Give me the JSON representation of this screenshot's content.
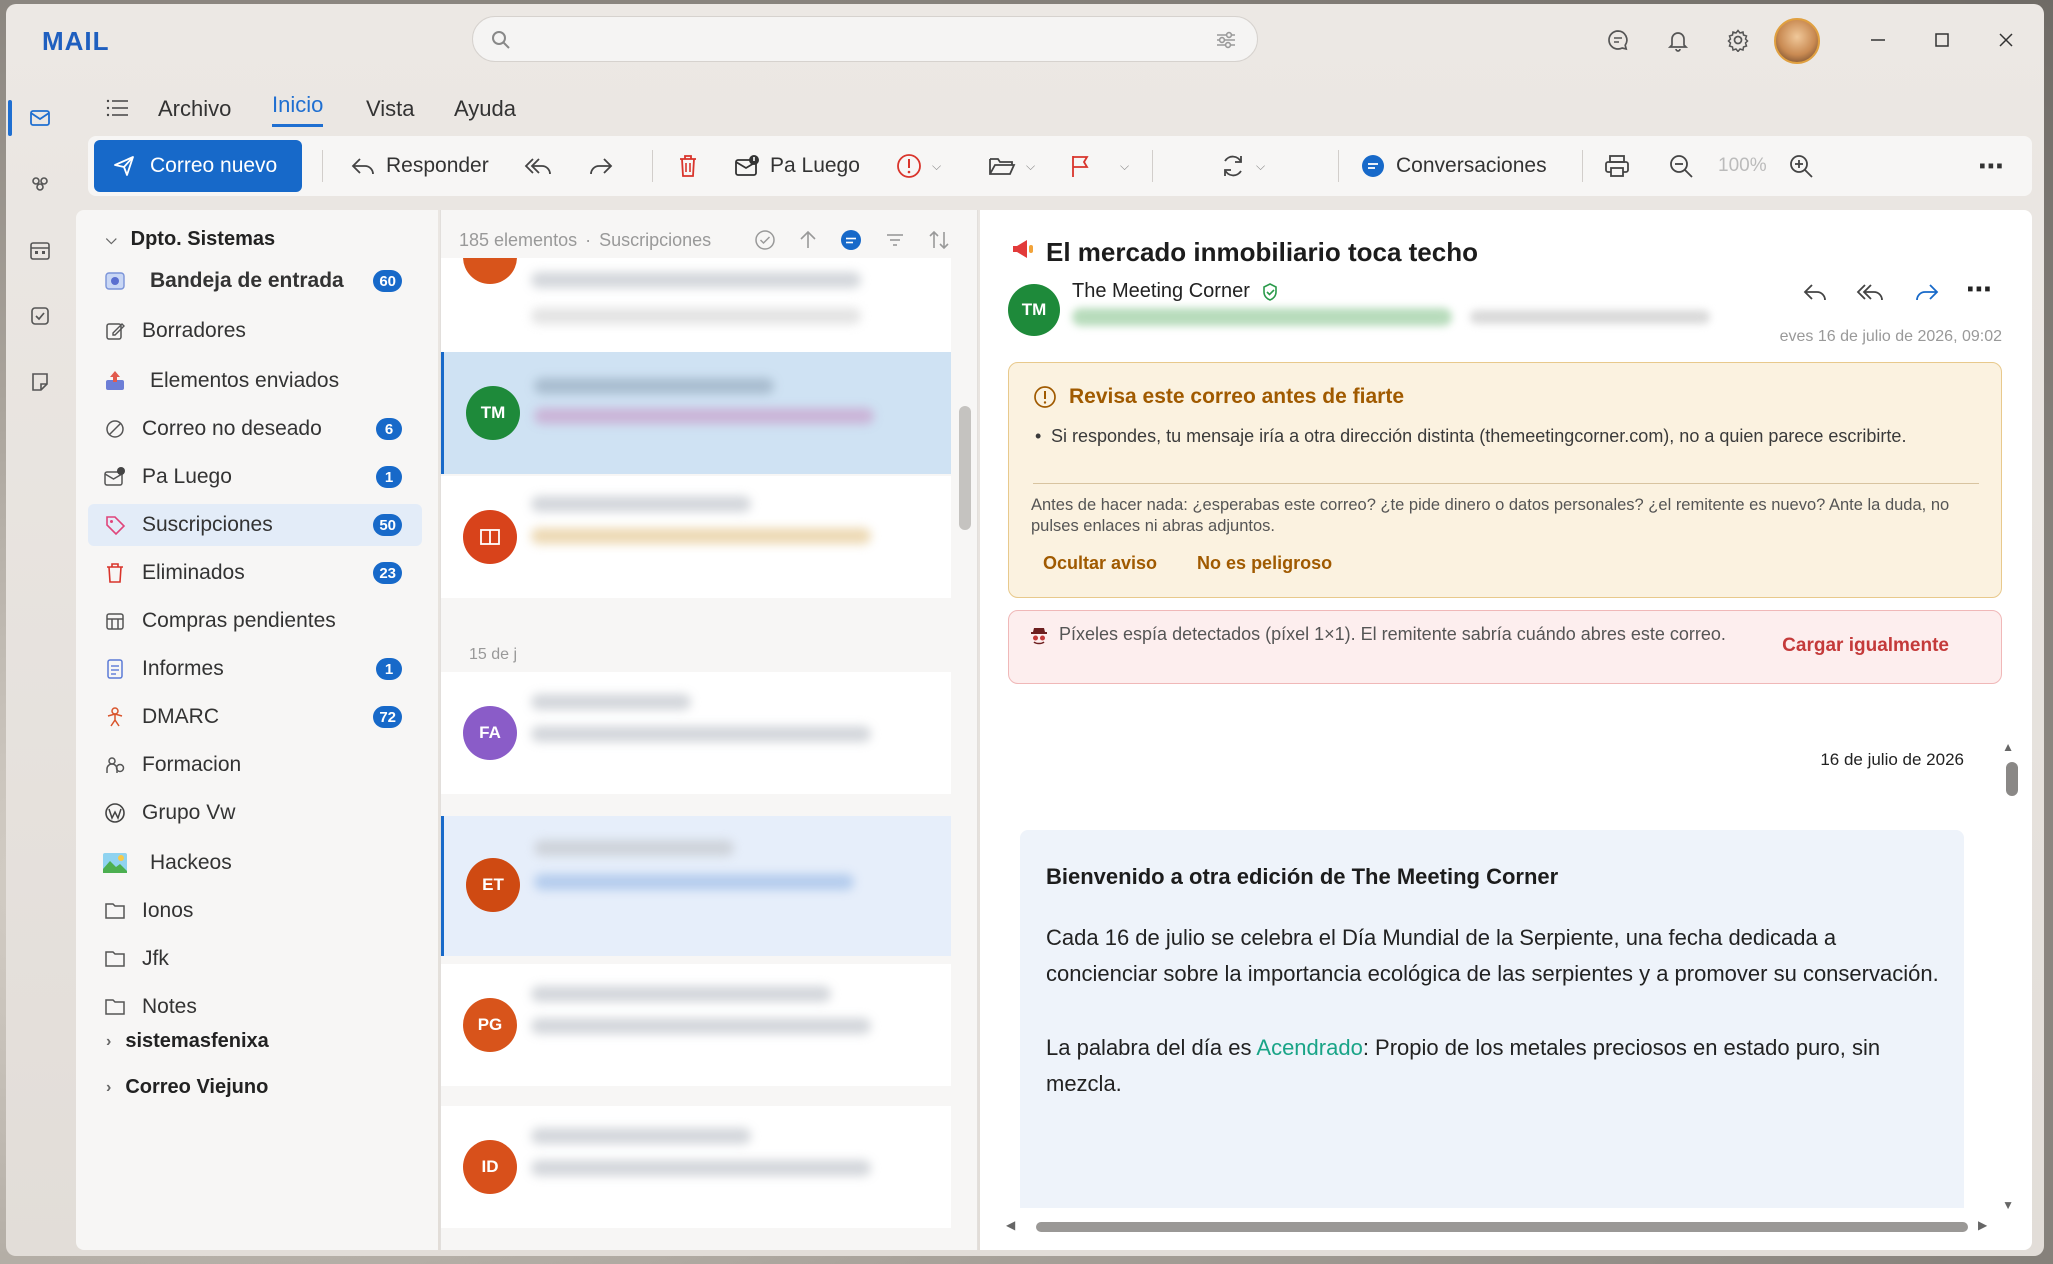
{
  "app": {
    "title": "MAIL"
  },
  "search": {
    "placeholder": ""
  },
  "menu": {
    "items": [
      "Archivo",
      "Inicio",
      "Vista",
      "Ayuda"
    ],
    "active": "Inicio"
  },
  "ribbon": {
    "new_mail": "Correo nuevo",
    "reply": "Responder",
    "later": "Pa Luego",
    "conversations": "Conversaciones",
    "zoom": "100%"
  },
  "sidebar": {
    "account": "Dpto. Sistemas",
    "folders": [
      {
        "label": "Bandeja de entrada",
        "count": "60",
        "bold": true
      },
      {
        "label": "Borradores",
        "count": ""
      },
      {
        "label": "Elementos enviados",
        "count": ""
      },
      {
        "label": "Correo no deseado",
        "count": "6"
      },
      {
        "label": "Pa Luego",
        "count": "1"
      },
      {
        "label": "Suscripciones",
        "count": "50"
      },
      {
        "label": "Eliminados",
        "count": "23"
      },
      {
        "label": "Compras pendientes",
        "count": ""
      },
      {
        "label": "Informes",
        "count": "1"
      },
      {
        "label": "DMARC",
        "count": "72"
      },
      {
        "label": "Formacion",
        "count": ""
      },
      {
        "label": "Grupo Vw",
        "count": ""
      },
      {
        "label": "Hackeos",
        "count": ""
      },
      {
        "label": "Ionos",
        "count": ""
      },
      {
        "label": "Jfk",
        "count": ""
      },
      {
        "label": "Notes",
        "count": ""
      }
    ],
    "groups": [
      "sistemasfenixa",
      "Correo Viejuno"
    ]
  },
  "list": {
    "count": "185 elementos",
    "folder": "Suscripciones",
    "date_separator": "15 de j",
    "items": [
      {
        "initials": "TM",
        "color": "#1e8a3a"
      },
      {
        "initials": "",
        "color": "#d8431b"
      },
      {
        "initials": "FA",
        "color": "#8a5cc8"
      },
      {
        "initials": "ET",
        "color": "#cf4a12"
      },
      {
        "initials": "PG",
        "color": "#d8541b"
      },
      {
        "initials": "ID",
        "color": "#d8501b"
      }
    ]
  },
  "reading": {
    "subject": "El mercado inmobiliario toca techo",
    "sender_initials": "TM",
    "sender_name": "The Meeting Corner",
    "sent": "eves 16 de julio de 2026, 09:02",
    "warning": {
      "title": "Revisa este correo antes de fiarte",
      "bullet": "Si respondes, tu mensaje iría a otra dirección distinta (themeetingcorner.com), no a quien parece escribirte.",
      "note": "Antes de hacer nada: ¿esperabas este correo? ¿te pide dinero o datos personales? ¿el remitente es nuevo? Ante la duda, no pulses enlaces ni abras adjuntos.",
      "hide": "Ocultar aviso",
      "safe": "No es peligroso"
    },
    "spy": {
      "text": "Píxeles espía detectados (píxel 1×1). El remitente sabría cuándo abres este correo.",
      "action": "Cargar igualmente"
    },
    "body": {
      "date": "16 de julio de 2026",
      "heading": "Bienvenido a otra edición de The Meeting Corner",
      "p1": "Cada 16 de julio se celebra el Día Mundial de la Serpiente, una fecha dedicada a concienciar sobre la importancia ecológica de las serpientes y a promover su conservación.",
      "p2_prefix": "La palabra del día es ",
      "p2_word": "Acendrado",
      "p2_suffix": ": Propio de los metales preciosos en estado puro, sin mezcla."
    }
  },
  "colors": {
    "accent": "#1769c9",
    "warn": "#a05a00",
    "danger": "#c43a3a",
    "link": "#19a487"
  }
}
